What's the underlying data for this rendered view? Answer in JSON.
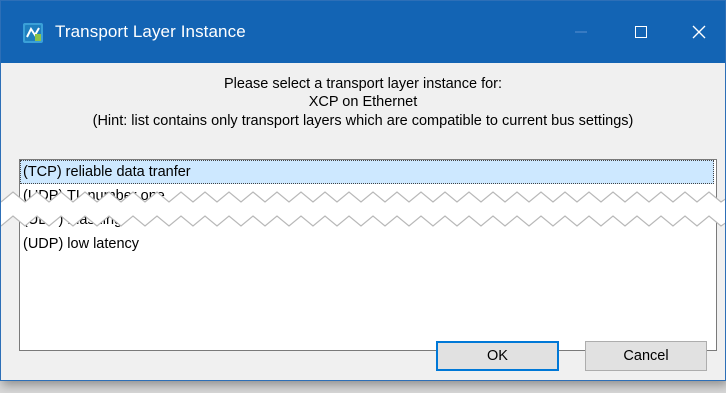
{
  "window": {
    "title": "Transport Layer Instance",
    "icon": "app-icon",
    "controls": {
      "minimize": "minimize-icon",
      "maximize": "maximize-icon",
      "close": "close-icon"
    }
  },
  "message": {
    "line1": "Please select a transport layer instance for:",
    "line2": "XCP on Ethernet",
    "line3": "(Hint: list contains only transport layers which are compatible to current bus settings)"
  },
  "list": {
    "selected_index": 0,
    "items": [
      "(TCP) reliable data tranfer",
      "(UDP) TL number one",
      "(UDP) Flashing",
      "(UDP) low latency"
    ]
  },
  "buttons": {
    "ok": "OK",
    "cancel": "Cancel"
  },
  "colors": {
    "titlebar": "#1364b4",
    "selection": "#cde8ff",
    "default_button_border": "#0078d7"
  }
}
